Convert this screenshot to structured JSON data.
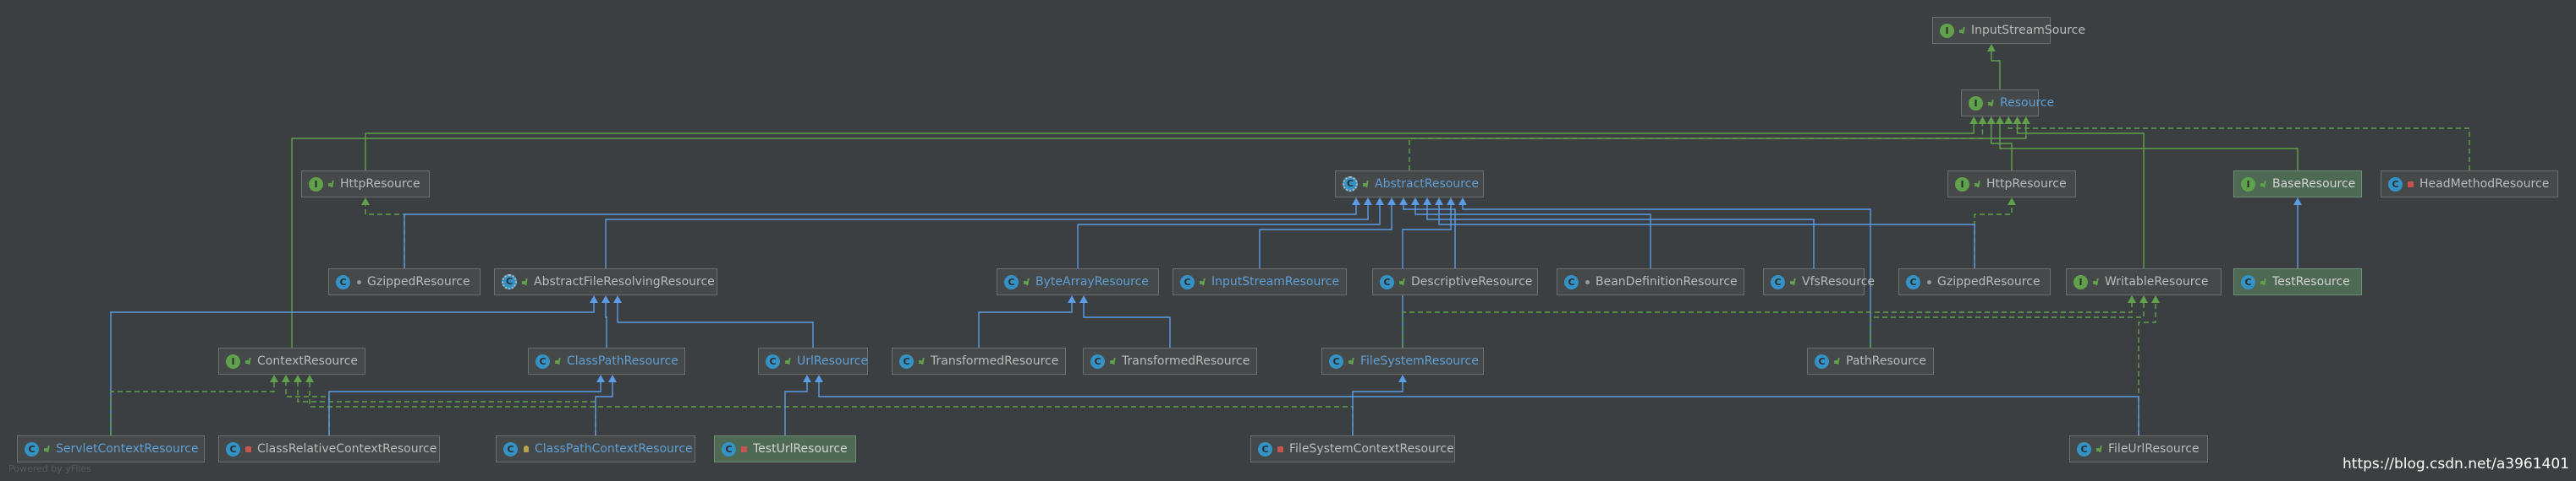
{
  "diagram": {
    "nodes": [
      {
        "id": "InputStreamSource",
        "label": "InputStreamSource",
        "kind": "interface",
        "vis": "pub",
        "link": false
      },
      {
        "id": "Resource",
        "label": "Resource",
        "kind": "interface",
        "vis": "pub",
        "link": true
      },
      {
        "id": "HttpResource1",
        "label": "HttpResource",
        "kind": "interface",
        "vis": "pub",
        "link": false
      },
      {
        "id": "AbstractResource",
        "label": "AbstractResource",
        "kind": "abstract",
        "vis": "pub",
        "link": true
      },
      {
        "id": "HttpResource2",
        "label": "HttpResource",
        "kind": "interface",
        "vis": "pub",
        "link": false
      },
      {
        "id": "BaseResource",
        "label": "BaseResource",
        "kind": "interface",
        "vis": "pub",
        "link": false,
        "highlight": true
      },
      {
        "id": "HeadMethodResource",
        "label": "HeadMethodResource",
        "kind": "class",
        "vis": "priv",
        "link": false
      },
      {
        "id": "GzippedResource1",
        "label": "GzippedResource",
        "kind": "class",
        "vis": "pkg",
        "link": false
      },
      {
        "id": "AbstractFileResolvingResource",
        "label": "AbstractFileResolvingResource",
        "kind": "abstract",
        "vis": "pub",
        "link": false
      },
      {
        "id": "ByteArrayResource",
        "label": "ByteArrayResource",
        "kind": "class",
        "vis": "pub",
        "link": true
      },
      {
        "id": "InputStreamResource",
        "label": "InputStreamResource",
        "kind": "class",
        "vis": "pub",
        "link": true
      },
      {
        "id": "DescriptiveResource",
        "label": "DescriptiveResource",
        "kind": "class",
        "vis": "pub",
        "link": false
      },
      {
        "id": "BeanDefinitionResource",
        "label": "BeanDefinitionResource",
        "kind": "class",
        "vis": "pkg",
        "link": false
      },
      {
        "id": "VfsResource",
        "label": "VfsResource",
        "kind": "class",
        "vis": "pub",
        "link": false
      },
      {
        "id": "GzippedResource2",
        "label": "GzippedResource",
        "kind": "class",
        "vis": "pkg",
        "link": false
      },
      {
        "id": "WritableResource",
        "label": "WritableResource",
        "kind": "interface",
        "vis": "pub",
        "link": false
      },
      {
        "id": "TestResource",
        "label": "TestResource",
        "kind": "class",
        "vis": "pub",
        "link": false,
        "highlight": true
      },
      {
        "id": "ContextResource",
        "label": "ContextResource",
        "kind": "interface",
        "vis": "pub",
        "link": false
      },
      {
        "id": "ClassPathResource",
        "label": "ClassPathResource",
        "kind": "class",
        "vis": "pub",
        "link": true
      },
      {
        "id": "UrlResource",
        "label": "UrlResource",
        "kind": "class",
        "vis": "pub",
        "link": true
      },
      {
        "id": "TransformedResource1",
        "label": "TransformedResource",
        "kind": "class",
        "vis": "pub",
        "link": false
      },
      {
        "id": "TransformedResource2",
        "label": "TransformedResource",
        "kind": "class",
        "vis": "pub",
        "link": false
      },
      {
        "id": "FileSystemResource",
        "label": "FileSystemResource",
        "kind": "class",
        "vis": "pub",
        "link": true
      },
      {
        "id": "PathResource",
        "label": "PathResource",
        "kind": "class",
        "vis": "pub",
        "link": false
      },
      {
        "id": "ServletContextResource",
        "label": "ServletContextResource",
        "kind": "class",
        "vis": "pub",
        "link": true
      },
      {
        "id": "ClassRelativeContextResource",
        "label": "ClassRelativeContextResource",
        "kind": "class",
        "vis": "priv",
        "link": false
      },
      {
        "id": "ClassPathContextResource",
        "label": "ClassPathContextResource",
        "kind": "class",
        "vis": "prot",
        "link": true
      },
      {
        "id": "TestUrlResource",
        "label": "TestUrlResource",
        "kind": "class",
        "vis": "priv",
        "link": false,
        "highlight": true
      },
      {
        "id": "FileSystemContextResource",
        "label": "FileSystemContextResource",
        "kind": "class",
        "vis": "priv",
        "link": false
      },
      {
        "id": "FileUrlResource",
        "label": "FileUrlResource",
        "kind": "class",
        "vis": "pub",
        "link": false
      }
    ],
    "edges": [
      {
        "from": "Resource",
        "to": "InputStreamSource",
        "type": "extends"
      },
      {
        "from": "HttpResource1",
        "to": "Resource",
        "type": "extends"
      },
      {
        "from": "AbstractResource",
        "to": "Resource",
        "type": "implements"
      },
      {
        "from": "HttpResource2",
        "to": "Resource",
        "type": "extends"
      },
      {
        "from": "BaseResource",
        "to": "Resource",
        "type": "extends"
      },
      {
        "from": "HeadMethodResource",
        "to": "Resource",
        "type": "implements"
      },
      {
        "from": "WritableResource",
        "to": "Resource",
        "type": "extends"
      },
      {
        "from": "ContextResource",
        "to": "Resource",
        "type": "extends"
      },
      {
        "from": "GzippedResource1",
        "to": "HttpResource1",
        "type": "implements"
      },
      {
        "from": "GzippedResource2",
        "to": "HttpResource2",
        "type": "implements"
      },
      {
        "from": "TestResource",
        "to": "BaseResource",
        "type": "extends-class"
      },
      {
        "from": "GzippedResource1",
        "to": "AbstractResource",
        "type": "extends-class"
      },
      {
        "from": "AbstractFileResolvingResource",
        "to": "AbstractResource",
        "type": "extends-class"
      },
      {
        "from": "ByteArrayResource",
        "to": "AbstractResource",
        "type": "extends-class"
      },
      {
        "from": "InputStreamResource",
        "to": "AbstractResource",
        "type": "extends-class"
      },
      {
        "from": "DescriptiveResource",
        "to": "AbstractResource",
        "type": "extends-class"
      },
      {
        "from": "BeanDefinitionResource",
        "to": "AbstractResource",
        "type": "extends-class"
      },
      {
        "from": "VfsResource",
        "to": "AbstractResource",
        "type": "extends-class"
      },
      {
        "from": "GzippedResource2",
        "to": "AbstractResource",
        "type": "extends-class"
      },
      {
        "from": "FileSystemResource",
        "to": "AbstractResource",
        "type": "extends-class"
      },
      {
        "from": "PathResource",
        "to": "AbstractResource",
        "type": "extends-class"
      },
      {
        "from": "ServletContextResource",
        "to": "AbstractFileResolvingResource",
        "type": "extends-class"
      },
      {
        "from": "ClassPathResource",
        "to": "AbstractFileResolvingResource",
        "type": "extends-class"
      },
      {
        "from": "UrlResource",
        "to": "AbstractFileResolvingResource",
        "type": "extends-class"
      },
      {
        "from": "TransformedResource1",
        "to": "ByteArrayResource",
        "type": "extends-class"
      },
      {
        "from": "TransformedResource2",
        "to": "ByteArrayResource",
        "type": "extends-class"
      },
      {
        "from": "FileSystemResource",
        "to": "WritableResource",
        "type": "implements"
      },
      {
        "from": "PathResource",
        "to": "WritableResource",
        "type": "implements"
      },
      {
        "from": "FileUrlResource",
        "to": "WritableResource",
        "type": "implements"
      },
      {
        "from": "ServletContextResource",
        "to": "ContextResource",
        "type": "implements"
      },
      {
        "from": "ClassRelativeContextResource",
        "to": "ContextResource",
        "type": "implements"
      },
      {
        "from": "ClassPathContextResource",
        "to": "ContextResource",
        "type": "implements"
      },
      {
        "from": "FileSystemContextResource",
        "to": "ContextResource",
        "type": "implements"
      },
      {
        "from": "ClassRelativeContextResource",
        "to": "ClassPathResource",
        "type": "extends-class"
      },
      {
        "from": "ClassPathContextResource",
        "to": "ClassPathResource",
        "type": "extends-class"
      },
      {
        "from": "TestUrlResource",
        "to": "UrlResource",
        "type": "extends-class"
      },
      {
        "from": "FileUrlResource",
        "to": "UrlResource",
        "type": "extends-class"
      },
      {
        "from": "FileSystemContextResource",
        "to": "FileSystemResource",
        "type": "extends-class"
      }
    ]
  },
  "footer": {
    "powered_by": "Powered by yFiles",
    "watermark": "https://blog.csdn.net/a3961401"
  },
  "colors": {
    "interface_edge": "#62a14c",
    "class_edge": "#5c9ce6",
    "background": "#3c3f41",
    "node_fill": "#45494a",
    "highlight_fill": "#4e6a55"
  }
}
